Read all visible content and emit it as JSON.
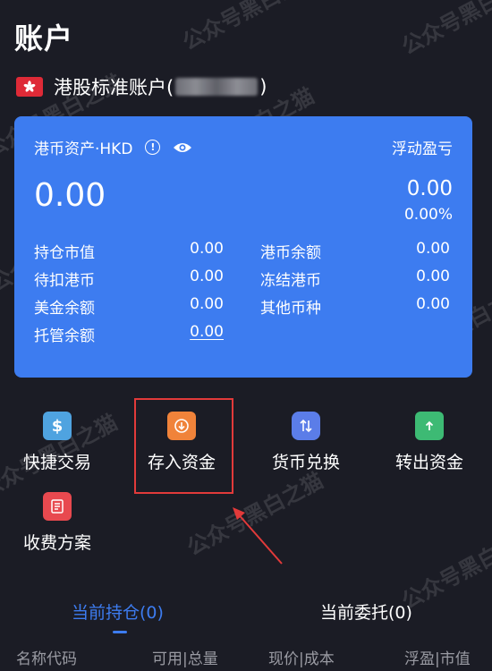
{
  "header": {
    "title": "账户"
  },
  "account": {
    "name_prefix": "港股标准账户(",
    "name_suffix": ")"
  },
  "card": {
    "asset_label": "港币资产·HKD",
    "float_label": "浮动盈亏",
    "total_value": "0.00",
    "float_value": "0.00",
    "float_pct": "0.00%",
    "rows": [
      {
        "label": "持仓市值",
        "value": "0.00"
      },
      {
        "label": "港币余额",
        "value": "0.00"
      },
      {
        "label": "待扣港币",
        "value": "0.00"
      },
      {
        "label": "冻结港币",
        "value": "0.00"
      },
      {
        "label": "美金余额",
        "value": "0.00"
      },
      {
        "label": "其他币种",
        "value": "0.00"
      },
      {
        "label": "托管余额",
        "value": "0.00"
      }
    ]
  },
  "actions": [
    {
      "label": "快捷交易",
      "icon": "dollar-bag-icon",
      "color": "#4fa3e0"
    },
    {
      "label": "存入资金",
      "icon": "deposit-icon",
      "color": "#f0833a"
    },
    {
      "label": "货币兑换",
      "icon": "exchange-icon",
      "color": "#5b7de8"
    },
    {
      "label": "转出资金",
      "icon": "withdraw-icon",
      "color": "#3dba74"
    },
    {
      "label": "收费方案",
      "icon": "fee-plan-icon",
      "color": "#e8494f"
    }
  ],
  "tabs": [
    {
      "label": "当前持仓(0)",
      "active": true
    },
    {
      "label": "当前委托(0)",
      "active": false
    }
  ],
  "columns": [
    "名称代码",
    "可用|总量",
    "现价|成本",
    "浮盈|市值"
  ],
  "watermark": "公众号黑白之猫",
  "colors": {
    "background": "#1b1c25",
    "card": "#3d7cf0",
    "accent": "#3d7cf0",
    "highlight": "#e23a3a"
  }
}
